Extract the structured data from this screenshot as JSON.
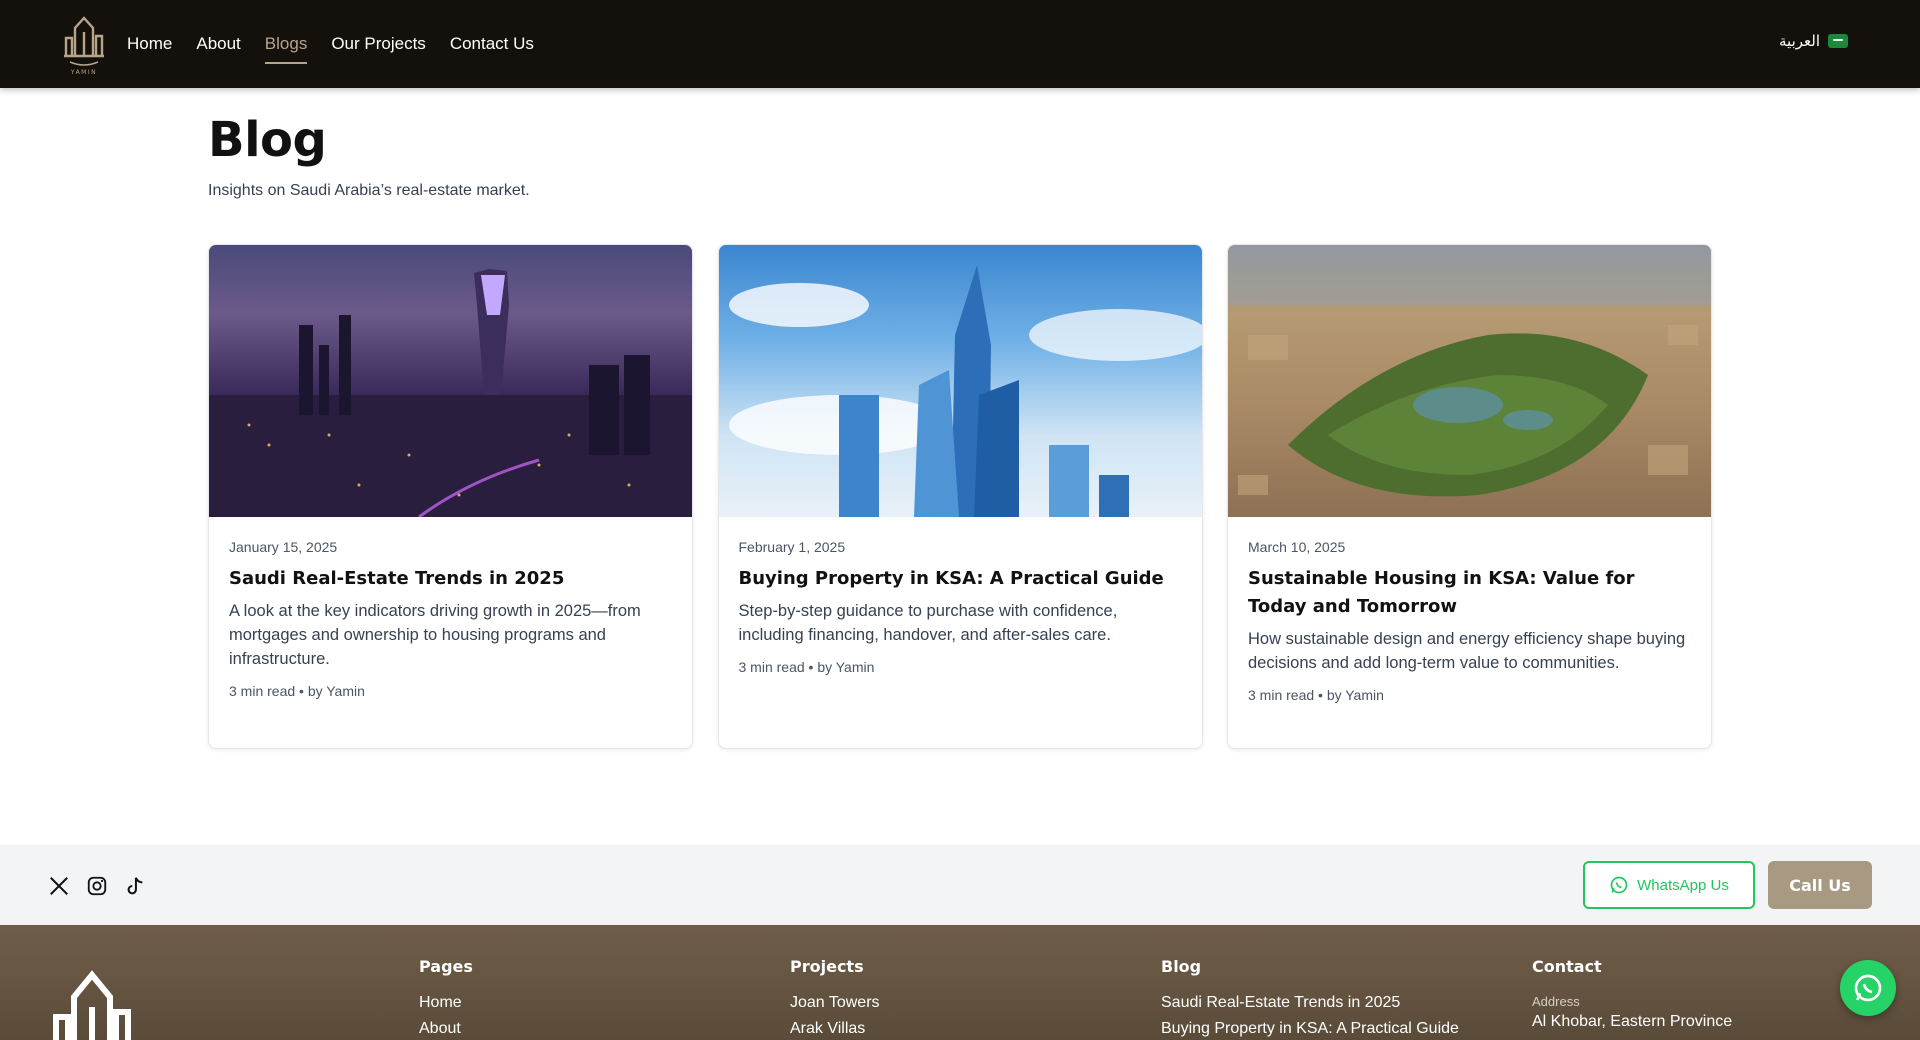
{
  "nav": {
    "logo_text": "YAMIN",
    "links": [
      {
        "label": "Home"
      },
      {
        "label": "About"
      },
      {
        "label": "Blogs"
      },
      {
        "label": "Our Projects"
      },
      {
        "label": "Contact Us"
      }
    ],
    "active_link": "Blogs",
    "language_label": "العربية"
  },
  "page": {
    "title": "Blog",
    "subtitle": "Insights on Saudi Arabia’s real-estate market."
  },
  "posts": [
    {
      "date": "January 15, 2025",
      "title": "Saudi Real-Estate Trends in 2025",
      "excerpt": "A look at the key indicators driving growth in 2025—from mortgages and ownership to housing programs and infrastructure.",
      "meta": "3 min read • by Yamin"
    },
    {
      "date": "February 1, 2025",
      "title": "Buying Property in KSA: A Practical Guide",
      "excerpt": "Step-by-step guidance to purchase with confidence, including financing, handover, and after-sales care.",
      "meta": "3 min read • by Yamin"
    },
    {
      "date": "March 10, 2025",
      "title": "Sustainable Housing in KSA: Value for Today and Tomorrow",
      "excerpt": "How sustainable design and energy efficiency shape buying decisions and add long-term value to communities.",
      "meta": "3 min read • by Yamin"
    }
  ],
  "contact_strip": {
    "socials": [
      "x-icon",
      "instagram-icon",
      "tiktok-icon"
    ],
    "whatsapp_label": "WhatsApp Us",
    "call_label": "Call Us"
  },
  "footer": {
    "pages": {
      "heading": "Pages",
      "links": [
        "Home",
        "About"
      ]
    },
    "projects": {
      "heading": "Projects",
      "links": [
        "Joan Towers",
        "Arak Villas"
      ]
    },
    "blog": {
      "heading": "Blog",
      "links": [
        "Saudi Real-Estate Trends in 2025",
        "Buying Property in KSA: A Practical Guide"
      ]
    },
    "contact": {
      "heading": "Contact",
      "address_label": "Address",
      "address": "Al Khobar, Eastern Province"
    }
  },
  "colors": {
    "nav_bg": "#14110d",
    "accent": "#b7a58a",
    "whatsapp": "#22c55e",
    "call_btn": "#a89a82",
    "footer_bg": "#5f4f3d"
  }
}
